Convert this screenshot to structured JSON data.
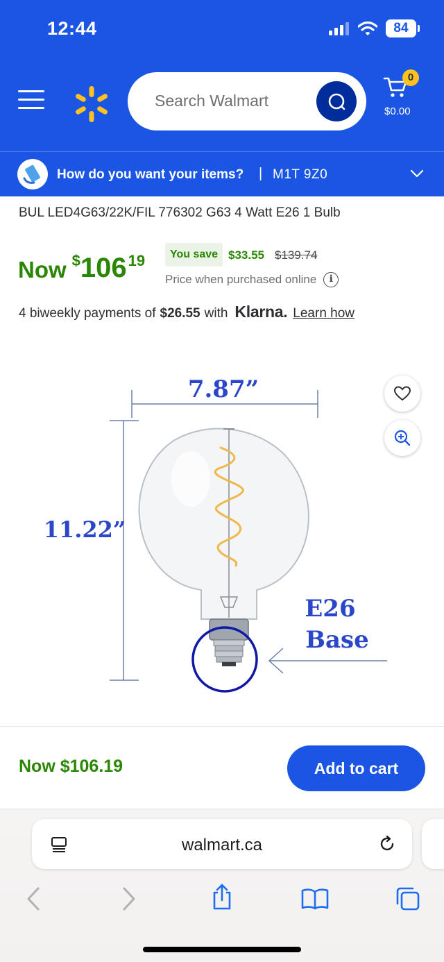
{
  "status_bar": {
    "time": "12:44",
    "battery": "84"
  },
  "header": {
    "search_placeholder": "Search Walmart",
    "cart_count": "0",
    "cart_total": "$0.00"
  },
  "delivery": {
    "question": "How do you want your items?",
    "separator": "|",
    "postal_code": "M1T 9Z0"
  },
  "product": {
    "title": "BUL LED4G63/22K/FIL 776302 G63 4 Watt E26 1 Bulb",
    "price": {
      "now_label": "Now",
      "currency": "$",
      "whole": "106",
      "cents": "19"
    },
    "savings": {
      "label": "You save",
      "amount": "$33.55",
      "was_price": "$139.74"
    },
    "online_note": "Price when purchased online",
    "info_icon": "i",
    "klarna": {
      "prefix": "4 biweekly payments of",
      "amount": "$26.55",
      "with": "with",
      "logo": "Klarna.",
      "link": "Learn how"
    },
    "image": {
      "width_label": "7.87”",
      "height_label": "11.22”",
      "base_label_1": "E26",
      "base_label_2": "Base"
    }
  },
  "footer": {
    "price": "Now $106.19",
    "add_to_cart": "Add to cart"
  },
  "browser": {
    "url": "walmart.ca"
  },
  "colors": {
    "brand_blue": "#1a55e3",
    "dark_blue": "#002d9c",
    "spark_yellow": "#ffc220",
    "price_green": "#2a8703"
  }
}
